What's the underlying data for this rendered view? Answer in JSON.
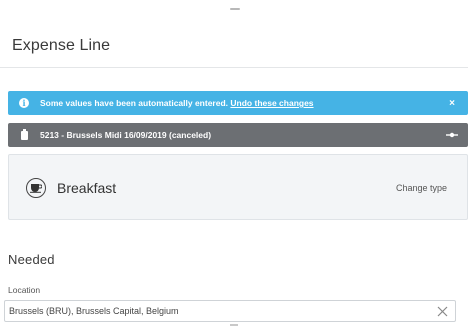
{
  "header": {
    "title": "Expense Line"
  },
  "info_bar": {
    "icon": "info-icon",
    "message": "Some values have been automatically entered.",
    "link": "Undo these changes",
    "close": "×",
    "color": "#45b3e5"
  },
  "trip_bar": {
    "icon": "clipboard-icon",
    "text": "5213 - Brussels Midi 16/09/2019 (canceled)",
    "toggle_icon": "toggle-icon",
    "color": "#6c6f73"
  },
  "expense_type": {
    "icon": "coffee-cup-icon",
    "label": "Breakfast",
    "change_label": "Change type"
  },
  "needed_section": {
    "title": "Needed",
    "location": {
      "label": "Location",
      "value": "Brussels (BRU), Brussels Capital, Belgium",
      "clear_icon": "clear-icon"
    }
  }
}
